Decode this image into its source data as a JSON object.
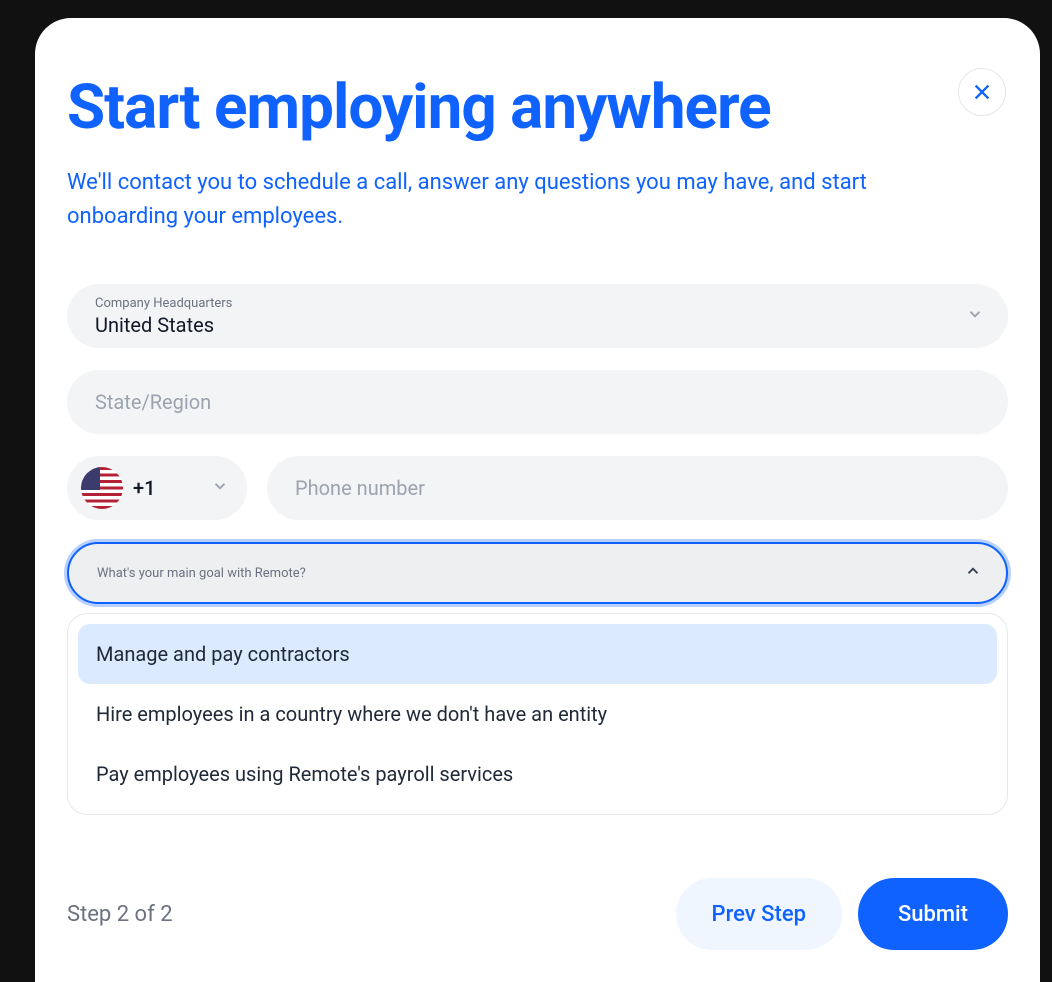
{
  "modal": {
    "title": "Start employing anywhere",
    "subtitle": "We'll contact you to schedule a call, answer any questions you may have, and start onboarding your employees."
  },
  "form": {
    "hq": {
      "label": "Company Headquarters",
      "value": "United States"
    },
    "state": {
      "placeholder": "State/Region"
    },
    "phone": {
      "dial_code": "+1",
      "placeholder": "Phone number"
    },
    "goal": {
      "label": "What's your main goal with Remote?",
      "options": [
        "Manage and pay contractors",
        "Hire employees in a country where we don't have an entity",
        "Pay employees using Remote's payroll services"
      ]
    }
  },
  "footer": {
    "step": "Step 2 of 2",
    "prev": "Prev Step",
    "submit": "Submit"
  }
}
